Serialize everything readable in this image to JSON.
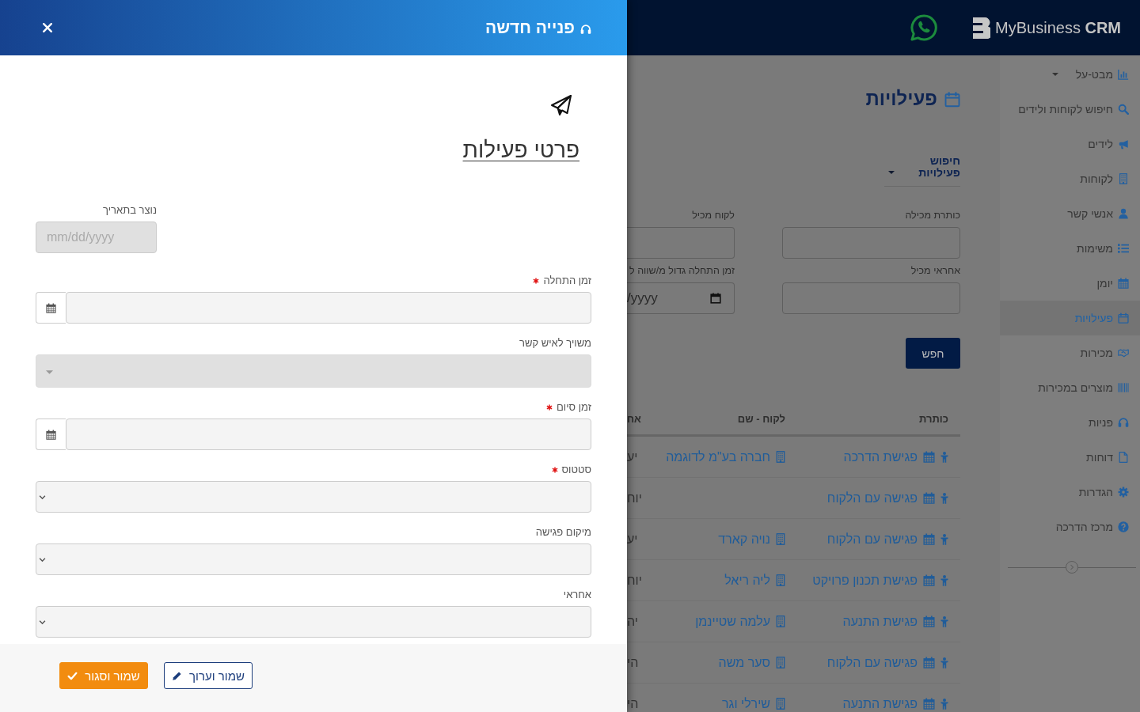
{
  "modal": {
    "title": "פנייה חדשה",
    "section_title": "פרטי פעילות",
    "fields": [
      {
        "label": "נוצר בתאריך",
        "kind": "date",
        "placeholder": "mm/dd/yyyy",
        "required": false,
        "disabled": true
      },
      {
        "label": "זמן התחלה",
        "kind": "datetime",
        "required": true,
        "disabled": false
      },
      {
        "label": "משויך לאיש קשר",
        "kind": "search-select",
        "required": false,
        "disabled": true
      },
      {
        "label": "זמן סיום",
        "kind": "datetime",
        "required": true,
        "disabled": false
      },
      {
        "label": "סטטוס",
        "kind": "select",
        "required": true,
        "disabled": false
      },
      {
        "label": "מיקום פגישה",
        "kind": "select",
        "required": false,
        "disabled": false
      },
      {
        "label": "אחראי",
        "kind": "select",
        "required": false,
        "disabled": false
      }
    ],
    "buttons": [
      {
        "label": "שמור וערוך",
        "kind": "secondary"
      },
      {
        "label": "שמור וסגור",
        "kind": "primary"
      }
    ]
  },
  "app": {
    "header": {
      "logo": "MyBusiness **CRM**"
    },
    "sidebar": {
      "items": [
        {
          "label": "מבט-על",
          "kind": "dropdown",
          "selected": false
        },
        {
          "label": "חיפוש לקוחות ולידים",
          "kind": "link",
          "selected": false
        },
        {
          "label": "לידים",
          "kind": "link",
          "selected": false
        },
        {
          "label": "לקוחות",
          "kind": "link",
          "selected": false
        },
        {
          "label": "אנשי קשר",
          "kind": "link",
          "selected": false
        },
        {
          "label": "משימות",
          "kind": "link",
          "selected": false
        },
        {
          "label": "יומן",
          "kind": "link",
          "selected": false
        },
        {
          "label": "פעילויות",
          "kind": "link",
          "selected": true
        },
        {
          "label": "מכירות",
          "kind": "link",
          "selected": false
        },
        {
          "label": "מוצרים במכירות",
          "kind": "link",
          "selected": false
        },
        {
          "label": "פניות",
          "kind": "link",
          "selected": false
        },
        {
          "label": "דוחות",
          "kind": "link",
          "selected": false
        },
        {
          "label": "הגדרות",
          "kind": "link",
          "selected": false
        },
        {
          "label": "מרכז הדרכה",
          "kind": "link",
          "selected": false
        }
      ]
    },
    "page": {
      "title": "פעילויות",
      "search_panel": {
        "title": "חיפוש פעילויות",
        "expanded": true,
        "fields": [
          {
            "label": "כותרת מכילה",
            "kind": "text"
          },
          {
            "label": "לקוח מכיל",
            "kind": "text"
          },
          {
            "label": "אחראי מכיל",
            "kind": "text"
          },
          {
            "label": "זמן התחלה גדול מ/שווה ל",
            "kind": "date",
            "placeholder": "/yyyy"
          }
        ],
        "button": "חפש"
      },
      "table": {
        "columns": [
          "כותרת",
          "לקוח - שם",
          "אח"
        ],
        "rows": [
          {
            "title": "פגישת הדרכה",
            "customer": "חברה בע\"מ לדוגמה",
            "column_3": "יע"
          },
          {
            "title": "פגישה עם הלקוח",
            "column_3": "יוח"
          },
          {
            "title": "פגישה עם הלקוח",
            "customer": "נויה קארד",
            "column_3": "יע"
          },
          {
            "title": "פגישת תכנון פרויקט",
            "customer": "ליה ריאל",
            "column_3": "יוח"
          },
          {
            "title": "פגישת התנעה",
            "customer": "עלמה שטיינמן",
            "column_3": "יה"
          },
          {
            "title": "פגישה עם הלקוח",
            "customer": "סער משה",
            "column_3": "הי"
          },
          {
            "title": "פגישת התנעה",
            "customer": "שירלי וגר",
            "column_3": "הי"
          }
        ]
      }
    }
  }
}
